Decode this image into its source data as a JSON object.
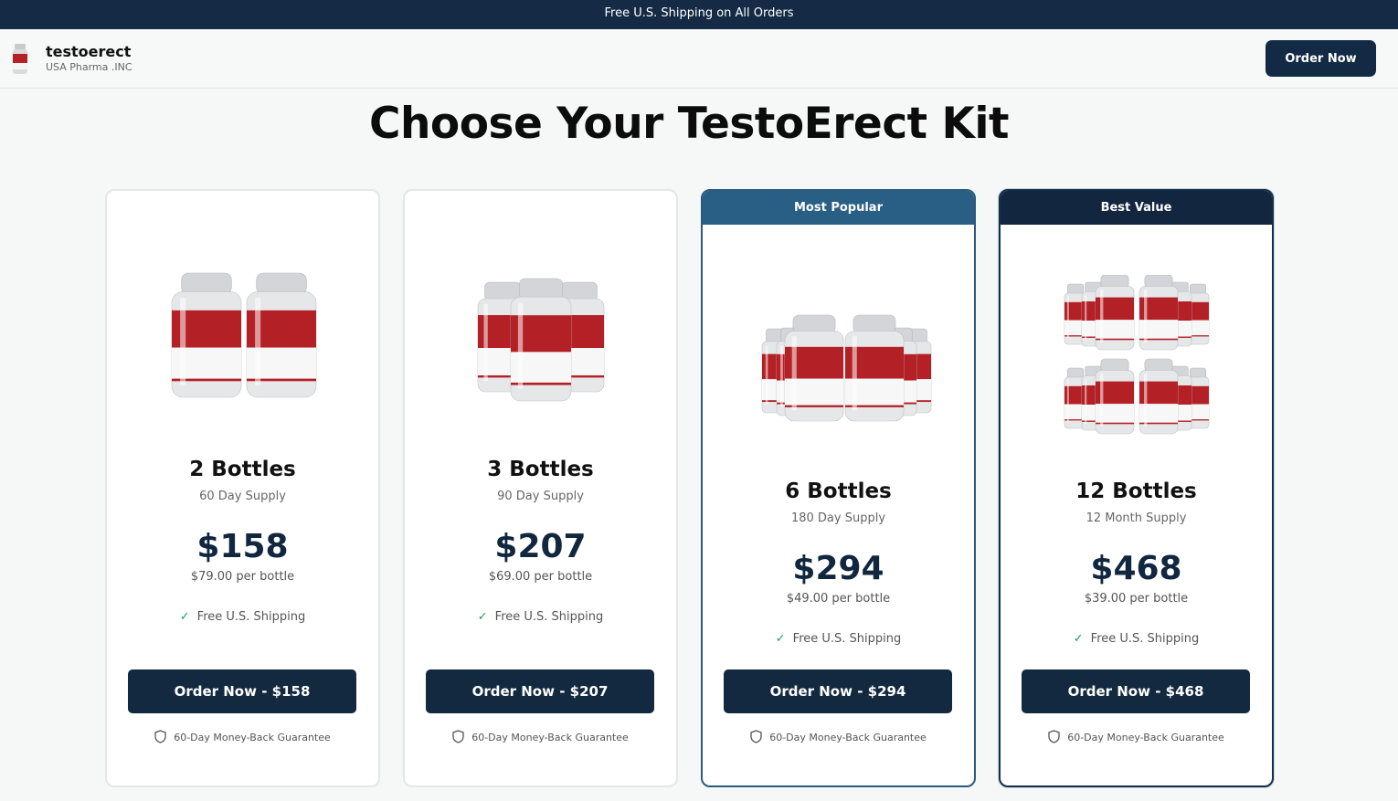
{
  "topbar": {
    "text": "Free U.S. Shipping on All Orders"
  },
  "header": {
    "brand_name": "testoerect",
    "brand_sub": "USA Pharma .INC",
    "order_label": "Order Now",
    "logo_icon": "bottle-icon"
  },
  "main": {
    "title": "Choose Your TestoErect Kit"
  },
  "colors": {
    "navy": "#12293f",
    "popular_badge": "#2a5f85",
    "check_green": "#1f9a5b",
    "bottle_red": "#b32025"
  },
  "cards": [
    {
      "badge": "",
      "title": "2 Bottles",
      "supply": "60 Day Supply",
      "price": "$158",
      "per_bottle": "$79.00 per bottle",
      "shipping": "Free U.S. Shipping",
      "button": "Order Now - $158",
      "guarantee": "60-Day Money-Back Guarantee",
      "bottle_count": 2
    },
    {
      "badge": "",
      "title": "3 Bottles",
      "supply": "90 Day Supply",
      "price": "$207",
      "per_bottle": "$69.00 per bottle",
      "shipping": "Free U.S. Shipping",
      "button": "Order Now - $207",
      "guarantee": "60-Day Money-Back Guarantee",
      "bottle_count": 3
    },
    {
      "badge": "Most Popular",
      "title": "6 Bottles",
      "supply": "180 Day Supply",
      "price": "$294",
      "per_bottle": "$49.00 per bottle",
      "shipping": "Free U.S. Shipping",
      "button": "Order Now - $294",
      "guarantee": "60-Day Money-Back Guarantee",
      "bottle_count": 6
    },
    {
      "badge": "Best Value",
      "title": "12 Bottles",
      "supply": "12 Month Supply",
      "price": "$468",
      "per_bottle": "$39.00 per bottle",
      "shipping": "Free U.S. Shipping",
      "button": "Order Now - $468",
      "guarantee": "60-Day Money-Back Guarantee",
      "bottle_count": 12
    }
  ],
  "icons": {
    "check": "check-icon",
    "guarantee": "shield-icon"
  }
}
